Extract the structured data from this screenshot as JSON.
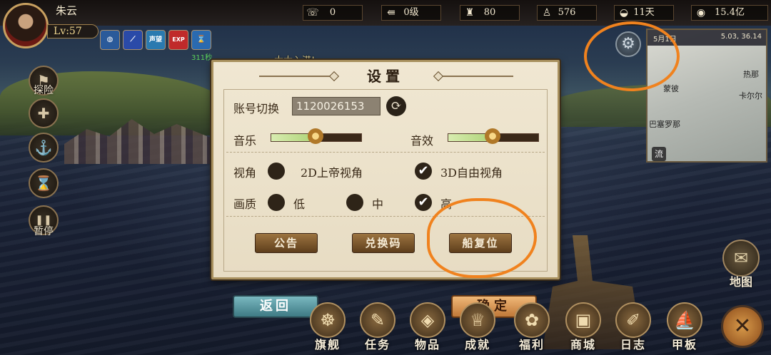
{
  "player": {
    "name": "朱云",
    "level": "Lv:57"
  },
  "resources": [
    {
      "icon": "phone-icon",
      "glyph": "☏",
      "value": "0"
    },
    {
      "icon": "arrows-icon",
      "glyph": "⇚",
      "value": "0级"
    },
    {
      "icon": "crew-icon",
      "glyph": "♜",
      "value": "80"
    },
    {
      "icon": "sailor-icon",
      "glyph": "♙",
      "value": "576"
    },
    {
      "icon": "bread-icon",
      "glyph": "◒",
      "value": "11天"
    },
    {
      "icon": "coin-icon",
      "glyph": "◉",
      "value": "15.4亿"
    }
  ],
  "buffs": {
    "items": [
      {
        "icon": "brain-icon",
        "text": "◍",
        "color": "#2a5a9a"
      },
      {
        "icon": "feather-icon",
        "text": "⟋",
        "color": "#2a4aa8"
      },
      {
        "icon": "reputation-icon",
        "text": "声望",
        "color": "#2a7ab0"
      },
      {
        "icon": "exp-icon",
        "text": "EXP",
        "color": "#c02a2a"
      },
      {
        "icon": "hourglass-icon",
        "text": "⌛",
        "color": "#2a6ab0"
      }
    ],
    "count": "311秒"
  },
  "system_message": "大大入港!",
  "side_buttons": [
    {
      "name": "explore-button",
      "glyph": "⚑",
      "label": "探险"
    },
    {
      "name": "cross-button",
      "glyph": "✚",
      "label": ""
    },
    {
      "name": "anchor-button",
      "glyph": "⚓",
      "label": ""
    },
    {
      "name": "hourglass-button",
      "glyph": "⌛",
      "label": ""
    },
    {
      "name": "pause-button",
      "glyph": "❚❚",
      "label": "暂停"
    }
  ],
  "minimap": {
    "date": "5月1日",
    "coords": "5.03, 36.14",
    "places": [
      "热那",
      "蒙彼",
      "巴塞罗那",
      "卡尔尔"
    ],
    "flow": "流"
  },
  "map_button": {
    "glyph": "✉",
    "label": "地图"
  },
  "settings": {
    "title": "设置",
    "account_label": "账号切换",
    "account_value": "1120026153",
    "music_label": "音乐",
    "sfx_label": "音效",
    "music_level": 0.55,
    "sfx_level": 0.55,
    "view_label": "视角",
    "view_options": [
      "2D上帝视角",
      "3D自由视角"
    ],
    "view_selected": "3D自由视角",
    "quality_label": "画质",
    "quality_options": [
      "低",
      "中",
      "高"
    ],
    "quality_selected": "高",
    "buttons": [
      "公告",
      "兑换码",
      "船复位"
    ]
  },
  "back_label": "返回",
  "ok_label": "确定",
  "nav": [
    {
      "icon": "wheel-icon",
      "glyph": "☸",
      "label": "旗舰"
    },
    {
      "icon": "scroll-icon",
      "glyph": "✎",
      "label": "任务"
    },
    {
      "icon": "bag-icon",
      "glyph": "◈",
      "label": "物品"
    },
    {
      "icon": "trophy-icon",
      "glyph": "♕",
      "label": "成就"
    },
    {
      "icon": "gift-icon",
      "glyph": "✿",
      "label": "福利"
    },
    {
      "icon": "chest-icon",
      "glyph": "▣",
      "label": "商城"
    },
    {
      "icon": "book-icon",
      "glyph": "✐",
      "label": "日志"
    },
    {
      "icon": "ship-icon",
      "glyph": "⛵",
      "label": "甲板"
    }
  ],
  "close_glyph": "✕"
}
